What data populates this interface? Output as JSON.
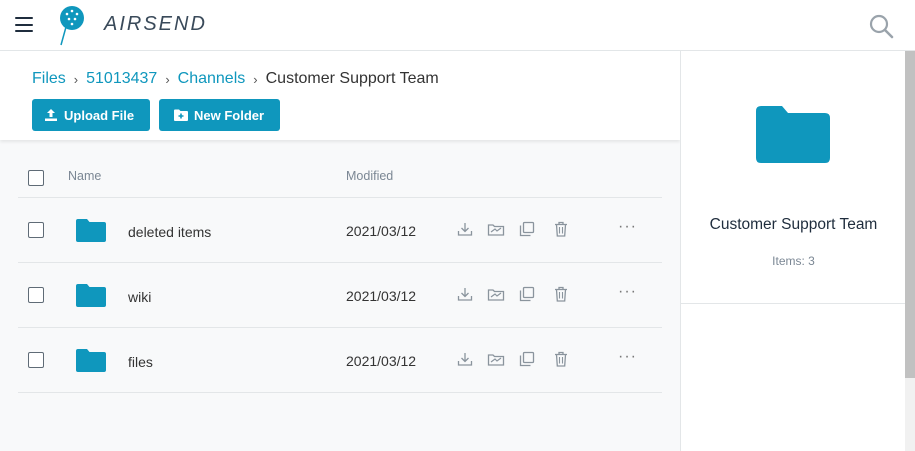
{
  "app": {
    "name": "AIRSEND"
  },
  "colors": {
    "accent": "#0f97bd",
    "text": "#333333",
    "muted": "#7b8794"
  },
  "breadcrumb": {
    "files": "Files",
    "workspace": "51013437",
    "channels": "Channels",
    "current": "Customer Support Team",
    "separator": "›"
  },
  "toolbar": {
    "upload_label": "Upload File",
    "new_folder_label": "New Folder"
  },
  "table": {
    "columns": {
      "name": "Name",
      "modified": "Modified"
    },
    "rows": [
      {
        "name": "deleted items",
        "modified": "2021/03/12"
      },
      {
        "name": "wiki",
        "modified": "2021/03/12"
      },
      {
        "name": "files",
        "modified": "2021/03/12"
      }
    ],
    "more": "···"
  },
  "details": {
    "title": "Customer Support Team",
    "items": "Items: 3"
  }
}
